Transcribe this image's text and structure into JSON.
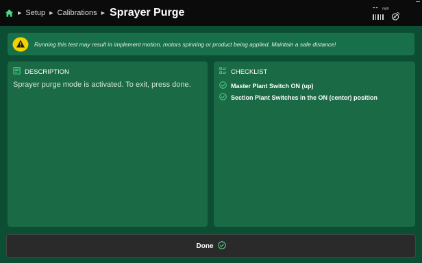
{
  "header": {
    "breadcrumb": [
      "Setup",
      "Calibrations"
    ],
    "title": "Sprayer Purge",
    "speed_value": "--",
    "speed_unit": "mph"
  },
  "warning": {
    "text": "Running this test may result in implement motion, motors spinning or product being applied. Maintain a safe distance!"
  },
  "description": {
    "heading": "DESCRIPTION",
    "text": "Sprayer purge mode is activated. To exit, press done."
  },
  "checklist": {
    "heading": "CHECKLIST",
    "items": [
      "Master Plant Switch ON (up)",
      "Section Plant Switches in the ON (center) position"
    ]
  },
  "footer": {
    "done_label": "Done"
  },
  "colors": {
    "background": "#0c4e34",
    "panel": "#1a6a45",
    "warning_bg": "#18704a",
    "accent_green": "#4fd68a",
    "warning_yellow": "#f2d200",
    "topbar": "#0b0b0b",
    "button": "#2a2a2a"
  },
  "icons": [
    "home-icon",
    "warning-icon",
    "description-icon",
    "checklist-icon",
    "check-circle-icon",
    "gps-icon"
  ]
}
